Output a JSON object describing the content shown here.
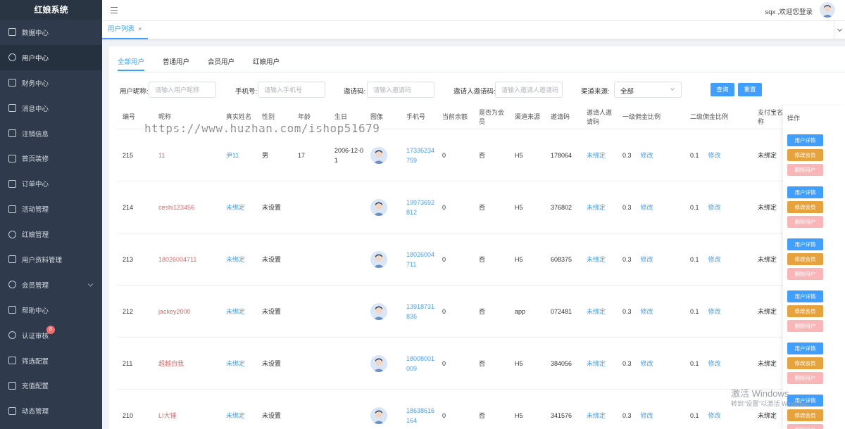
{
  "app": {
    "title": "红娘系统"
  },
  "sidebar": {
    "items": [
      {
        "label": "数据中心",
        "icon": "chart-icon"
      },
      {
        "label": "用户中心",
        "icon": "user-icon",
        "active": true
      },
      {
        "label": "财务中心",
        "icon": "wallet-icon"
      },
      {
        "label": "消息中心",
        "icon": "message-icon"
      },
      {
        "label": "注销信息",
        "icon": "document-icon"
      },
      {
        "label": "首页装修",
        "icon": "box-icon"
      },
      {
        "label": "订单中心",
        "icon": "order-icon"
      },
      {
        "label": "活动管理",
        "icon": "clipboard-icon"
      },
      {
        "label": "红娘管理",
        "icon": "person-icon"
      },
      {
        "label": "用户资料管理",
        "icon": "profile-icon"
      },
      {
        "label": "会员管理",
        "icon": "vip-icon",
        "expandable": true
      },
      {
        "label": "帮助中心",
        "icon": "help-icon"
      },
      {
        "label": "认证审核",
        "icon": "verify-icon",
        "badge": "8"
      },
      {
        "label": "筛选配置",
        "icon": "filter-icon"
      },
      {
        "label": "充值配置",
        "icon": "recharge-icon"
      },
      {
        "label": "动态管理",
        "icon": "moments-icon"
      }
    ]
  },
  "header": {
    "welcome": "sqx ,欢迎您登录"
  },
  "page_tabs": [
    {
      "label": "用户列表",
      "close": "×"
    }
  ],
  "user_tabs": [
    "全部用户",
    "普通用户",
    "会员用户",
    "红娘用户"
  ],
  "watermark": "https://www.huzhan.com/ishop51679",
  "filters": {
    "nickname_label": "用户昵称:",
    "nickname_placeholder": "请输入用户昵称",
    "phone_label": "手机号:",
    "phone_placeholder": "请输入手机号",
    "invite_label": "邀请码:",
    "invite_placeholder": "请输入邀请码",
    "inviter_label": "邀请人邀请码:",
    "inviter_placeholder": "请输入邀请人邀请码",
    "channel_label": "渠道来源:",
    "channel_value": "全部",
    "query": "查询",
    "reset": "重置"
  },
  "table": {
    "headers": {
      "id": "编号",
      "nickname": "昵称",
      "realname": "真实姓名",
      "gender": "性别",
      "age": "年龄",
      "birthday": "生日",
      "avatar": "图像",
      "phone": "手机号",
      "balance": "当前余额",
      "member": "是否为会员",
      "channel": "渠道来源",
      "invite": "邀请码",
      "inviter": "邀请人邀请码",
      "rate1": "一级佣金比例",
      "rate2": "二级佣金比例",
      "alipay": "支付宝名称",
      "ops": "操作"
    },
    "rows": [
      {
        "id": "215",
        "nickname": "11",
        "realname": "尹11",
        "gender": "男",
        "age": "17",
        "birthday": "2006-12-01",
        "phone": "17336234759",
        "balance": "0",
        "member": "否",
        "channel": "H5",
        "invite": "178064",
        "inviter": "未绑定",
        "rate1": "0.3",
        "rate2": "0.1",
        "alipay": "未绑定"
      },
      {
        "id": "214",
        "nickname": "ceshi123456",
        "realname": "未绑定",
        "gender": "未设置",
        "age": "",
        "birthday": "",
        "phone": "19973692812",
        "balance": "0",
        "member": "否",
        "channel": "H5",
        "invite": "376802",
        "inviter": "未绑定",
        "rate1": "0.3",
        "rate2": "0.1",
        "alipay": "未绑定"
      },
      {
        "id": "213",
        "nickname": "18026004711",
        "realname": "未绑定",
        "gender": "未设置",
        "age": "",
        "birthday": "",
        "phone": "18026004711",
        "balance": "0",
        "member": "否",
        "channel": "H5",
        "invite": "608375",
        "inviter": "未绑定",
        "rate1": "0.3",
        "rate2": "0.1",
        "alipay": "未绑定"
      },
      {
        "id": "212",
        "nickname": "jackey2000",
        "realname": "未绑定",
        "gender": "未设置",
        "age": "",
        "birthday": "",
        "phone": "13918731836",
        "balance": "0",
        "member": "否",
        "channel": "app",
        "invite": "072481",
        "inviter": "未绑定",
        "rate1": "0.3",
        "rate2": "0.1",
        "alipay": "未绑定"
      },
      {
        "id": "211",
        "nickname": "超越自我",
        "realname": "未绑定",
        "gender": "未设置",
        "age": "",
        "birthday": "",
        "phone": "18008001009",
        "balance": "0",
        "member": "否",
        "channel": "H5",
        "invite": "384056",
        "inviter": "未绑定",
        "rate1": "0.3",
        "rate2": "0.1",
        "alipay": "未绑定"
      },
      {
        "id": "210",
        "nickname": "LI大锤",
        "realname": "未绑定",
        "gender": "未设置",
        "age": "",
        "birthday": "",
        "phone": "18638616164",
        "balance": "0",
        "member": "否",
        "channel": "H5",
        "invite": "341576",
        "inviter": "未绑定",
        "rate1": "0.3",
        "rate2": "0.1",
        "alipay": "未绑定"
      }
    ],
    "edit_label": "修改",
    "actions": {
      "detail": "用户详情",
      "edit_member": "修改会员",
      "delete": "删除用户"
    }
  },
  "os_notice": {
    "title": "激活 Windows",
    "sub": "转到\"设置\"以激活 Windows。"
  },
  "colors": {
    "sidebar": "#2f3b4c",
    "primary": "#409eff",
    "warning": "#e6a23c",
    "danger_light": "#fab6b6",
    "nickname": "#e06a6a"
  }
}
